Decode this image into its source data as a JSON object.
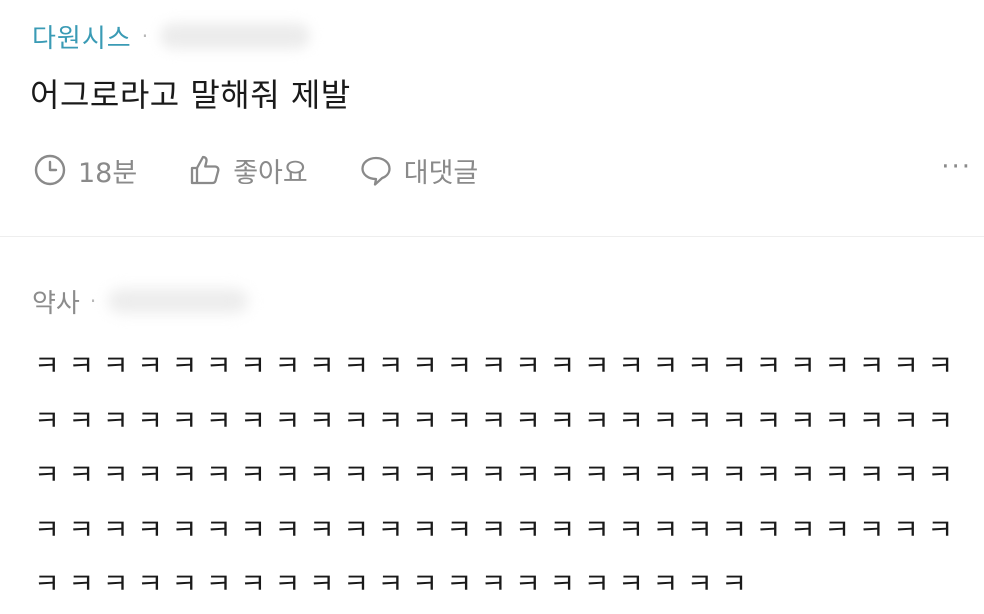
{
  "post": {
    "author": "다원시스",
    "separator": "·",
    "title": "어그로라고 말해줘 제발",
    "actions": {
      "time": {
        "icon": "clock-icon",
        "label": "18분"
      },
      "like": {
        "icon": "thumbs-up-icon",
        "label": "좋아요"
      },
      "comment": {
        "icon": "speech-bubble-icon",
        "label": "대댓글"
      },
      "more": {
        "icon": "more-icon",
        "label": "···"
      }
    }
  },
  "reply": {
    "author": "약사",
    "separator": "·",
    "body": "ㅋㅋㅋㅋㅋㅋㅋㅋㅋㅋㅋㅋㅋㅋㅋㅋㅋㅋㅋㅋㅋㅋㅋㅋㅋㅋㅋㅋㅋㅋㅋㅋㅋㅋㅋㅋㅋㅋㅋㅋㅋㅋㅋㅋㅋㅋㅋㅋㅋㅋㅋㅋㅋㅋㅋㅋㅋㅋㅋㅋㅋㅋㅋㅋㅋㅋㅋㅋㅋㅋㅋㅋㅋㅋㅋㅋㅋㅋㅋㅋㅋㅋㅋㅋㅋㅋㅋㅋㅋㅋㅋㅋㅋㅋㅋㅋㅋㅋㅋㅋㅋㅋㅋㅋㅋㅋㅋㅋㅋㅋㅋㅋㅋㅋㅋㅋㅋㅋㅋㅋㅋㅋㅋㅋㅋㅋㅋㅋㅋ"
  },
  "colors": {
    "author_accent": "#3a9bb5",
    "muted": "#8a8a8a",
    "text": "#1a1a1a"
  }
}
